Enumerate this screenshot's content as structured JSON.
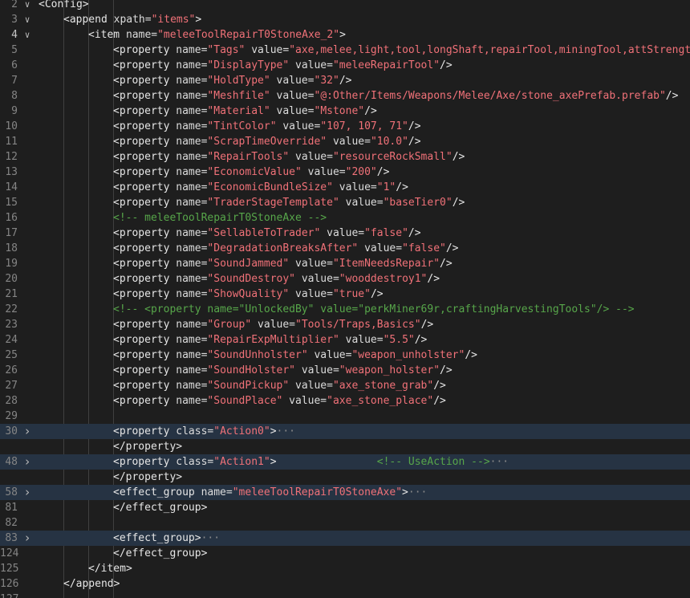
{
  "editor": {
    "lines": [
      {
        "n": "2",
        "fold": "chevron-down",
        "indent": 0,
        "tokens": [
          {
            "k": "t",
            "v": "<Config>"
          }
        ]
      },
      {
        "n": "3",
        "fold": "chevron-down",
        "indent": 1,
        "tokens": [
          {
            "k": "t",
            "v": "<append "
          },
          {
            "k": "a",
            "v": "xpath="
          },
          {
            "k": "s",
            "v": "\"items\""
          },
          {
            "k": "t",
            "v": ">"
          }
        ]
      },
      {
        "n": "4",
        "fold": "chevron-down",
        "indent": 2,
        "active": true,
        "tokens": [
          {
            "k": "t",
            "v": "<item "
          },
          {
            "k": "a",
            "v": "name="
          },
          {
            "k": "s",
            "v": "\"meleeToolRepairT0StoneAxe_2\""
          },
          {
            "k": "t",
            "v": ">"
          }
        ]
      },
      {
        "n": "5",
        "indent": 3,
        "tokens": [
          {
            "k": "t",
            "v": "<property "
          },
          {
            "k": "a",
            "v": "name="
          },
          {
            "k": "s",
            "v": "\"Tags\""
          },
          {
            "k": "a",
            "v": " value="
          },
          {
            "k": "s",
            "v": "\"axe,melee,light,tool,longShaft,repairTool,miningTool,attStrength,"
          }
        ]
      },
      {
        "n": "6",
        "indent": 3,
        "tokens": [
          {
            "k": "t",
            "v": "<property "
          },
          {
            "k": "a",
            "v": "name="
          },
          {
            "k": "s",
            "v": "\"DisplayType\""
          },
          {
            "k": "a",
            "v": " value="
          },
          {
            "k": "s",
            "v": "\"meleeRepairTool\""
          },
          {
            "k": "t",
            "v": "/>"
          }
        ]
      },
      {
        "n": "7",
        "indent": 3,
        "tokens": [
          {
            "k": "t",
            "v": "<property "
          },
          {
            "k": "a",
            "v": "name="
          },
          {
            "k": "s",
            "v": "\"HoldType\""
          },
          {
            "k": "a",
            "v": " value="
          },
          {
            "k": "s",
            "v": "\"32\""
          },
          {
            "k": "t",
            "v": "/>"
          }
        ]
      },
      {
        "n": "8",
        "indent": 3,
        "tokens": [
          {
            "k": "t",
            "v": "<property "
          },
          {
            "k": "a",
            "v": "name="
          },
          {
            "k": "s",
            "v": "\"Meshfile\""
          },
          {
            "k": "a",
            "v": " value="
          },
          {
            "k": "s",
            "v": "\"@:Other/Items/Weapons/Melee/Axe/stone_axePrefab.prefab\""
          },
          {
            "k": "t",
            "v": "/>"
          }
        ]
      },
      {
        "n": "9",
        "indent": 3,
        "tokens": [
          {
            "k": "t",
            "v": "<property "
          },
          {
            "k": "a",
            "v": "name="
          },
          {
            "k": "s",
            "v": "\"Material\""
          },
          {
            "k": "a",
            "v": " value="
          },
          {
            "k": "s",
            "v": "\"Mstone\""
          },
          {
            "k": "t",
            "v": "/>"
          }
        ]
      },
      {
        "n": "10",
        "indent": 3,
        "tokens": [
          {
            "k": "t",
            "v": "<property "
          },
          {
            "k": "a",
            "v": "name="
          },
          {
            "k": "s",
            "v": "\"TintColor\""
          },
          {
            "k": "a",
            "v": " value="
          },
          {
            "k": "s",
            "v": "\"107, 107, 71\""
          },
          {
            "k": "t",
            "v": "/>"
          }
        ]
      },
      {
        "n": "11",
        "indent": 3,
        "tokens": [
          {
            "k": "t",
            "v": "<property "
          },
          {
            "k": "a",
            "v": "name="
          },
          {
            "k": "s",
            "v": "\"ScrapTimeOverride\""
          },
          {
            "k": "a",
            "v": " value="
          },
          {
            "k": "s",
            "v": "\"10.0\""
          },
          {
            "k": "t",
            "v": "/>"
          }
        ]
      },
      {
        "n": "12",
        "indent": 3,
        "tokens": [
          {
            "k": "t",
            "v": "<property "
          },
          {
            "k": "a",
            "v": "name="
          },
          {
            "k": "s",
            "v": "\"RepairTools\""
          },
          {
            "k": "a",
            "v": " value="
          },
          {
            "k": "s",
            "v": "\"resourceRockSmall\""
          },
          {
            "k": "t",
            "v": "/>"
          }
        ]
      },
      {
        "n": "13",
        "indent": 3,
        "tokens": [
          {
            "k": "t",
            "v": "<property "
          },
          {
            "k": "a",
            "v": "name="
          },
          {
            "k": "s",
            "v": "\"EconomicValue\""
          },
          {
            "k": "a",
            "v": " value="
          },
          {
            "k": "s",
            "v": "\"200\""
          },
          {
            "k": "t",
            "v": "/>"
          }
        ]
      },
      {
        "n": "14",
        "indent": 3,
        "tokens": [
          {
            "k": "t",
            "v": "<property "
          },
          {
            "k": "a",
            "v": "name="
          },
          {
            "k": "s",
            "v": "\"EconomicBundleSize\""
          },
          {
            "k": "a",
            "v": " value="
          },
          {
            "k": "s",
            "v": "\"1\""
          },
          {
            "k": "t",
            "v": "/>"
          }
        ]
      },
      {
        "n": "15",
        "indent": 3,
        "tokens": [
          {
            "k": "t",
            "v": "<property "
          },
          {
            "k": "a",
            "v": "name="
          },
          {
            "k": "s",
            "v": "\"TraderStageTemplate\""
          },
          {
            "k": "a",
            "v": " value="
          },
          {
            "k": "s",
            "v": "\"baseTier0\""
          },
          {
            "k": "t",
            "v": "/>"
          }
        ]
      },
      {
        "n": "16",
        "indent": 3,
        "tokens": [
          {
            "k": "c",
            "v": "<!-- meleeToolRepairT0StoneAxe -->"
          }
        ]
      },
      {
        "n": "17",
        "indent": 3,
        "tokens": [
          {
            "k": "t",
            "v": "<property "
          },
          {
            "k": "a",
            "v": "name="
          },
          {
            "k": "s",
            "v": "\"SellableToTrader\""
          },
          {
            "k": "a",
            "v": " value="
          },
          {
            "k": "s",
            "v": "\"false\""
          },
          {
            "k": "t",
            "v": "/>"
          }
        ]
      },
      {
        "n": "18",
        "indent": 3,
        "tokens": [
          {
            "k": "t",
            "v": "<property "
          },
          {
            "k": "a",
            "v": "name="
          },
          {
            "k": "s",
            "v": "\"DegradationBreaksAfter\""
          },
          {
            "k": "a",
            "v": " value="
          },
          {
            "k": "s",
            "v": "\"false\""
          },
          {
            "k": "t",
            "v": "/>"
          }
        ]
      },
      {
        "n": "19",
        "indent": 3,
        "tokens": [
          {
            "k": "t",
            "v": "<property "
          },
          {
            "k": "a",
            "v": "name="
          },
          {
            "k": "s",
            "v": "\"SoundJammed\""
          },
          {
            "k": "a",
            "v": " value="
          },
          {
            "k": "s",
            "v": "\"ItemNeedsRepair\""
          },
          {
            "k": "t",
            "v": "/>"
          }
        ]
      },
      {
        "n": "20",
        "indent": 3,
        "tokens": [
          {
            "k": "t",
            "v": "<property "
          },
          {
            "k": "a",
            "v": "name="
          },
          {
            "k": "s",
            "v": "\"SoundDestroy\""
          },
          {
            "k": "a",
            "v": " value="
          },
          {
            "k": "s",
            "v": "\"wooddestroy1\""
          },
          {
            "k": "t",
            "v": "/>"
          }
        ]
      },
      {
        "n": "21",
        "indent": 3,
        "tokens": [
          {
            "k": "t",
            "v": "<property "
          },
          {
            "k": "a",
            "v": "name="
          },
          {
            "k": "s",
            "v": "\"ShowQuality\""
          },
          {
            "k": "a",
            "v": " value="
          },
          {
            "k": "s",
            "v": "\"true\""
          },
          {
            "k": "t",
            "v": "/>"
          }
        ]
      },
      {
        "n": "22",
        "indent": 3,
        "tokens": [
          {
            "k": "c",
            "v": "<!-- <property name=\"UnlockedBy\" value=\"perkMiner69r,craftingHarvestingTools\"/> -->"
          }
        ]
      },
      {
        "n": "23",
        "indent": 3,
        "tokens": [
          {
            "k": "t",
            "v": "<property "
          },
          {
            "k": "a",
            "v": "name="
          },
          {
            "k": "s",
            "v": "\"Group\""
          },
          {
            "k": "a",
            "v": " value="
          },
          {
            "k": "s",
            "v": "\"Tools/Traps,Basics\""
          },
          {
            "k": "t",
            "v": "/>"
          }
        ]
      },
      {
        "n": "24",
        "indent": 3,
        "tokens": [
          {
            "k": "t",
            "v": "<property "
          },
          {
            "k": "a",
            "v": "name="
          },
          {
            "k": "s",
            "v": "\"RepairExpMultiplier\""
          },
          {
            "k": "a",
            "v": " value="
          },
          {
            "k": "s",
            "v": "\"5.5\""
          },
          {
            "k": "t",
            "v": "/>"
          }
        ]
      },
      {
        "n": "25",
        "indent": 3,
        "tokens": [
          {
            "k": "t",
            "v": "<property "
          },
          {
            "k": "a",
            "v": "name="
          },
          {
            "k": "s",
            "v": "\"SoundUnholster\""
          },
          {
            "k": "a",
            "v": " value="
          },
          {
            "k": "s",
            "v": "\"weapon_unholster\""
          },
          {
            "k": "t",
            "v": "/>"
          }
        ]
      },
      {
        "n": "26",
        "indent": 3,
        "tokens": [
          {
            "k": "t",
            "v": "<property "
          },
          {
            "k": "a",
            "v": "name="
          },
          {
            "k": "s",
            "v": "\"SoundHolster\""
          },
          {
            "k": "a",
            "v": " value="
          },
          {
            "k": "s",
            "v": "\"weapon_holster\""
          },
          {
            "k": "t",
            "v": "/>"
          }
        ]
      },
      {
        "n": "27",
        "indent": 3,
        "tokens": [
          {
            "k": "t",
            "v": "<property "
          },
          {
            "k": "a",
            "v": "name="
          },
          {
            "k": "s",
            "v": "\"SoundPickup\""
          },
          {
            "k": "a",
            "v": " value="
          },
          {
            "k": "s",
            "v": "\"axe_stone_grab\""
          },
          {
            "k": "t",
            "v": "/>"
          }
        ]
      },
      {
        "n": "28",
        "indent": 3,
        "tokens": [
          {
            "k": "t",
            "v": "<property "
          },
          {
            "k": "a",
            "v": "name="
          },
          {
            "k": "s",
            "v": "\"SoundPlace\""
          },
          {
            "k": "a",
            "v": " value="
          },
          {
            "k": "s",
            "v": "\"axe_stone_place\""
          },
          {
            "k": "t",
            "v": "/>"
          }
        ]
      },
      {
        "n": "29",
        "indent": 3,
        "tokens": []
      },
      {
        "n": "30",
        "fold": "chevron-right",
        "hl": true,
        "indent": 3,
        "tokens": [
          {
            "k": "t",
            "v": "<property "
          },
          {
            "k": "a",
            "v": "class="
          },
          {
            "k": "s",
            "v": "\"Action0\""
          },
          {
            "k": "t",
            "v": ">"
          },
          {
            "k": "e",
            "v": "···"
          }
        ]
      },
      {
        "n": "",
        "indent": 3,
        "tokens": [
          {
            "k": "t",
            "v": "</property>"
          }
        ]
      },
      {
        "n": "48",
        "fold": "chevron-right",
        "hl": true,
        "indent": 3,
        "tokens": [
          {
            "k": "t",
            "v": "<property "
          },
          {
            "k": "a",
            "v": "class="
          },
          {
            "k": "s",
            "v": "\"Action1\""
          },
          {
            "k": "t",
            "v": ">"
          },
          {
            "k": "t",
            "v": "                "
          },
          {
            "k": "c",
            "v": "<!-- UseAction -->"
          },
          {
            "k": "e",
            "v": "···"
          }
        ]
      },
      {
        "n": "",
        "indent": 3,
        "tokens": [
          {
            "k": "t",
            "v": "</property>"
          }
        ]
      },
      {
        "n": "58",
        "fold": "chevron-right",
        "hl": true,
        "indent": 3,
        "tokens": [
          {
            "k": "t",
            "v": "<effect_group "
          },
          {
            "k": "a",
            "v": "name="
          },
          {
            "k": "s",
            "v": "\"meleeToolRepairT0StoneAxe\""
          },
          {
            "k": "t",
            "v": ">"
          },
          {
            "k": "e",
            "v": "···"
          }
        ]
      },
      {
        "n": "81",
        "indent": 3,
        "tokens": [
          {
            "k": "t",
            "v": "</effect_group>"
          }
        ]
      },
      {
        "n": "82",
        "indent": 3,
        "tokens": []
      },
      {
        "n": "83",
        "fold": "chevron-right",
        "hl": true,
        "indent": 3,
        "tokens": [
          {
            "k": "t",
            "v": "<effect_group>"
          },
          {
            "k": "e",
            "v": "···"
          }
        ]
      },
      {
        "n": "124",
        "indent": 3,
        "tokens": [
          {
            "k": "t",
            "v": "</effect_group>"
          }
        ]
      },
      {
        "n": "125",
        "indent": 2,
        "tokens": [
          {
            "k": "t",
            "v": "</item>"
          }
        ]
      },
      {
        "n": "126",
        "indent": 1,
        "tokens": [
          {
            "k": "t",
            "v": "</append>"
          }
        ]
      },
      {
        "n": "127",
        "indent": 0,
        "tokens": []
      }
    ]
  },
  "colors": {
    "background": "#1e1e1e",
    "fold_highlight": "#263343",
    "tag": "#e6e6e6",
    "string": "#f07178",
    "comment": "#57a64a",
    "line_number": "#858585"
  }
}
